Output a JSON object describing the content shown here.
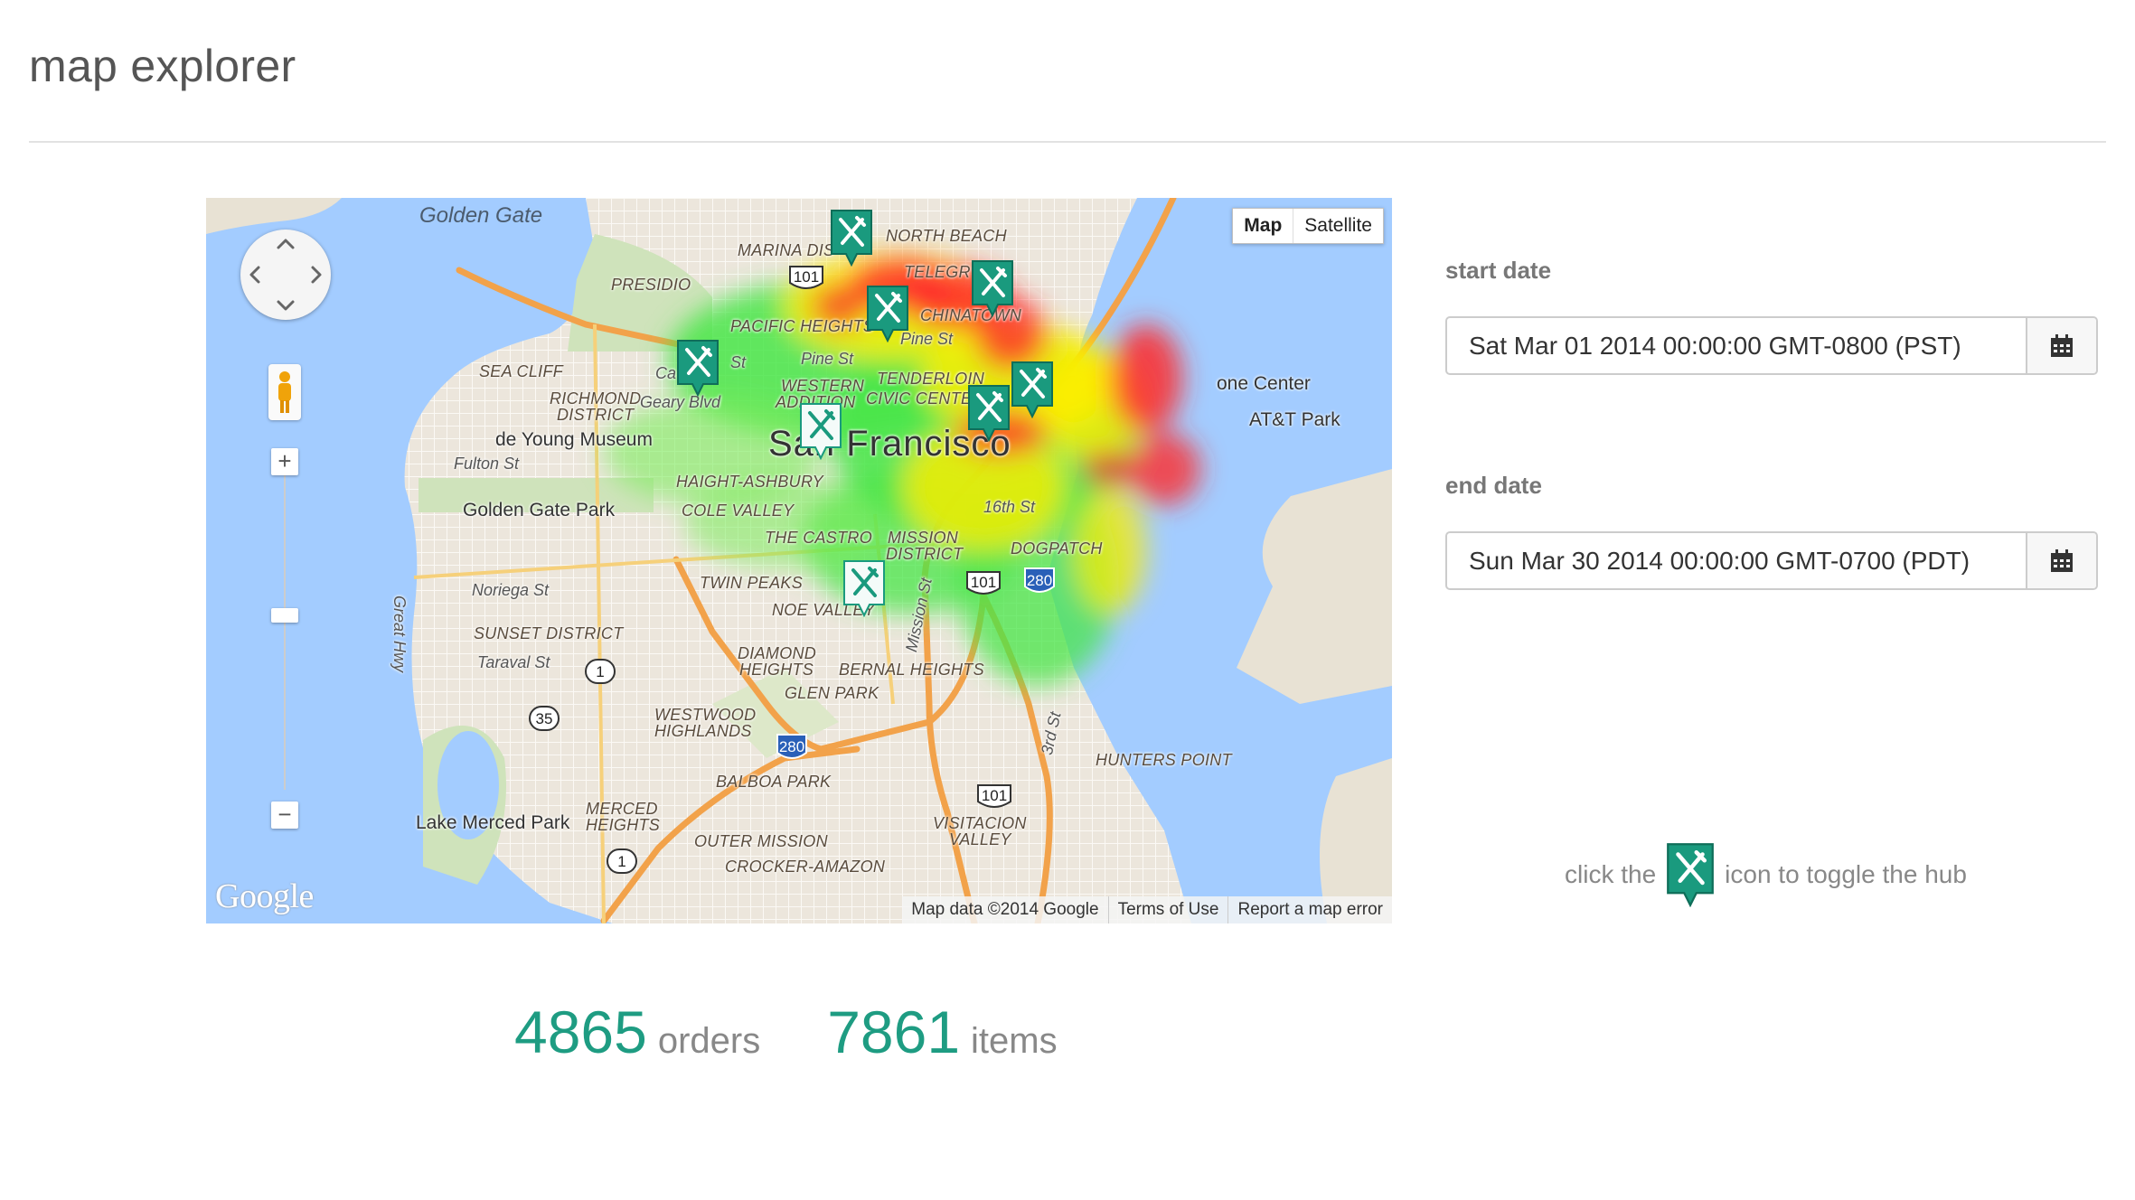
{
  "header": {
    "title": "map explorer"
  },
  "map": {
    "type_controls": {
      "map": "Map",
      "satellite": "Satellite"
    },
    "labels": {
      "golden_gate": "Golden Gate",
      "presidio": "PRESIDIO",
      "marina": "MARINA DIS",
      "north_beach": "NORTH BEACH",
      "telegraph": "TELEGR",
      "chinatown": "CHINATOWN",
      "pacific_heights": "PACIFIC HEIGHTS",
      "pine_st": "Pine St",
      "pine_st2": "Pine St",
      "sea_cliff": "SEA CLIFF",
      "richmond": "RICHMOND",
      "district": "DISTRICT",
      "geary": "Geary Blvd",
      "western": "WESTERN",
      "addition": "ADDITION",
      "tenderloin": "TENDERLOIN",
      "civic": "CIVIC CENTER",
      "one_center": "one Center",
      "att_park": "AT&T Park",
      "city": "San Francisco",
      "de_young": "de Young Museum",
      "fulton": "Fulton St",
      "haight": "HAIGHT-ASHBURY",
      "golden_gate_park": "Golden Gate Park",
      "cole_valley": "COLE VALLEY",
      "castro": "THE CASTRO",
      "mission_dist": "MISSION",
      "mission_dist2": "DISTRICT",
      "st16": "16th St",
      "dogpatch": "DOGPATCH",
      "great_hwy": "Great Hwy",
      "noriega": "Noriega St",
      "twin_peaks": "TWIN PEAKS",
      "noe_valley": "NOE VALLEY",
      "mission_st": "Mission St",
      "sunset": "SUNSET DISTRICT",
      "taraval": "Taraval St",
      "diamond": "DIAMOND",
      "heights": "HEIGHTS",
      "bernal": "BERNAL HEIGHTS",
      "glen_park": "GLEN PARK",
      "westwood": "WESTWOOD",
      "highlands": "HIGHLANDS",
      "third_st": "3rd St",
      "hunters_point": "HUNTERS POINT",
      "balboa": "BALBOA PARK",
      "lake_merced": "Lake Merced Park",
      "merced": "MERCED",
      "merced2": "HEIGHTS",
      "outer_mission": "OUTER MISSION",
      "crocker": "CROCKER-AMAZON",
      "visitacion": "VISITACION",
      "valley": "VALLEY",
      "calif": "Ca",
      "st_frag": "St"
    },
    "shields": {
      "r1a": "1",
      "r1b": "1",
      "r35": "35",
      "r101a": "101",
      "r101b": "101",
      "r101c": "101",
      "i280a": "280",
      "i280b": "280"
    },
    "logo": "Google",
    "attribution": {
      "data": "Map data ©2014 Google",
      "terms": "Terms of Use",
      "report": "Report a map error"
    },
    "hub_icon": "fork-knife-icon"
  },
  "filters": {
    "start_label": "start date",
    "start_value": "Sat Mar 01 2014 00:00:00 GMT-0800 (PST)",
    "end_label": "end date",
    "end_value": "Sun Mar 30 2014 00:00:00 GMT-0700 (PDT)",
    "calendar_icon": "calendar-icon"
  },
  "hint": {
    "before": "click the",
    "after": "icon to toggle the hub"
  },
  "stats": {
    "orders_count": "4865",
    "orders_label": "orders",
    "items_count": "7861",
    "items_label": "items"
  },
  "colors": {
    "accent": "#1e9c82",
    "hub": "#1a9a7e",
    "heat_hot": "#ff2a2a",
    "heat_warm": "#ffee00",
    "heat_cool": "#48e648"
  }
}
